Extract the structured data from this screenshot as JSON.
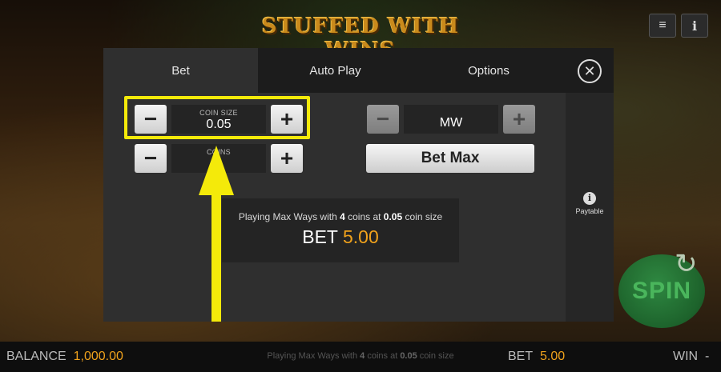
{
  "game": {
    "logo_text": "STUFFED WITH WINS"
  },
  "top_buttons": {
    "menu_icon": "≡",
    "info_icon": "i"
  },
  "tabs": [
    {
      "label": "Bet",
      "active": true
    },
    {
      "label": "Auto Play",
      "active": false
    },
    {
      "label": "Options",
      "active": false
    }
  ],
  "close_icon": "✕",
  "coin_size": {
    "label": "COIN SIZE",
    "value": "0.05",
    "minus": "−",
    "plus": "+"
  },
  "coins": {
    "label": "COINS",
    "value": "",
    "minus": "−",
    "plus": "+"
  },
  "ways": {
    "value": "MW",
    "minus": "−",
    "plus": "+"
  },
  "bet_max_label": "Bet Max",
  "summary": {
    "prefix": "Playing Max Ways with ",
    "coins": "4",
    "middle": " coins at ",
    "coin_size": "0.05",
    "suffix": " coin size",
    "bet_label": "BET",
    "bet_amount": "5.00"
  },
  "paytable": {
    "icon": "i",
    "label": "Paytable"
  },
  "spin": {
    "label": "SPIN"
  },
  "status": {
    "balance_label": "BALANCE",
    "balance_value": "1,000.00",
    "bet_label": "BET",
    "bet_value": "5.00",
    "win_label": "WIN",
    "win_value": "-"
  },
  "colors": {
    "highlight": "#f4ea0a",
    "accent": "#f0a21c",
    "spin_green": "#2e9a4a"
  }
}
